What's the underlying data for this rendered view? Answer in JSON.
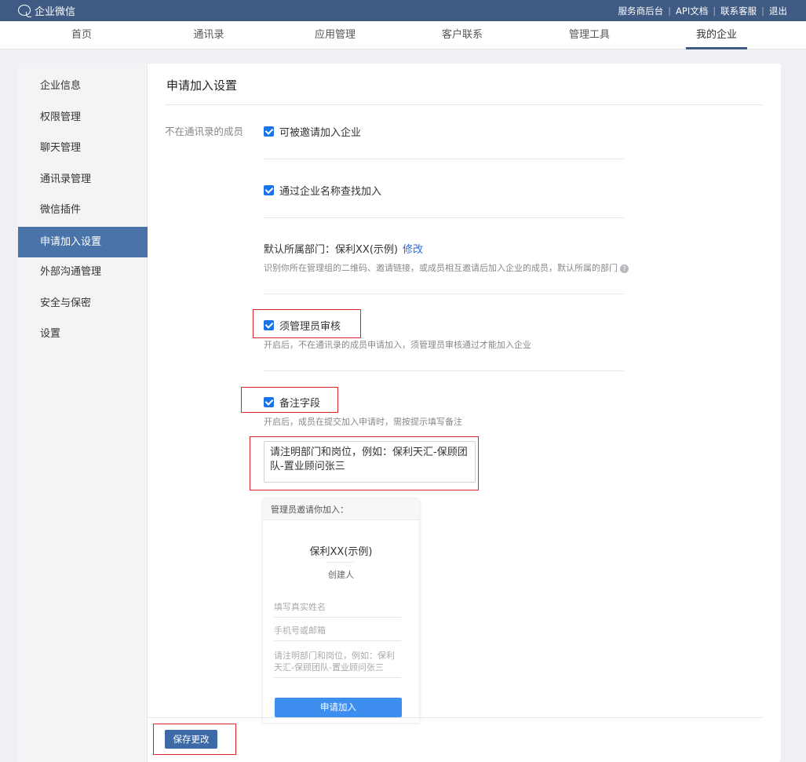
{
  "header": {
    "logo_text": "企业微信",
    "links": [
      "服务商后台",
      "API文档",
      "联系客服",
      "退出"
    ]
  },
  "nav": {
    "items": [
      "首页",
      "通讯录",
      "应用管理",
      "客户联系",
      "管理工具",
      "我的企业"
    ],
    "active": "我的企业"
  },
  "sidebar": {
    "items": [
      "企业信息",
      "权限管理",
      "聊天管理",
      "通讯录管理",
      "微信插件",
      "申请加入设置",
      "外部沟通管理",
      "安全与保密",
      "设置"
    ],
    "active": "申请加入设置"
  },
  "main": {
    "title": "申请加入设置",
    "row_label": "不在通讯录的成员",
    "option_invite": "可被邀请加入企业",
    "option_search": "通过企业名称查找加入",
    "dept_label": "默认所属部门：",
    "dept_value": "保利XX(示例)",
    "dept_edit": "修改",
    "dept_hint": "识别你所在管理组的二维码、邀请链接，或成员相互邀请后加入企业的成员，默认所属的部门",
    "option_review": "须管理员审核",
    "review_hint": "开启后，不在通讯录的成员申请加入，须管理员审核通过才能加入企业",
    "option_note": "备注字段",
    "note_hint": "开启后，成员在提交加入申请时，需按提示填写备注",
    "note_value": "请注明部门和岗位，例如：保利天汇-保顾团队-置业顾问张三"
  },
  "preview": {
    "header": "管理员邀请你加入：",
    "company": "保利XX(示例)",
    "role": "创建人",
    "field_name": "填写真实姓名",
    "field_phone": "手机号或邮箱",
    "field_note": "请注明部门和岗位，例如：保利天汇-保顾团队-置业顾问张三",
    "submit": "申请加入"
  },
  "footer": {
    "save": "保存更改"
  },
  "colors": {
    "topbar": "#3f5a83",
    "accent": "#4a74a9",
    "checkbox": "#1a73e8",
    "highlight": "#d9262b"
  }
}
